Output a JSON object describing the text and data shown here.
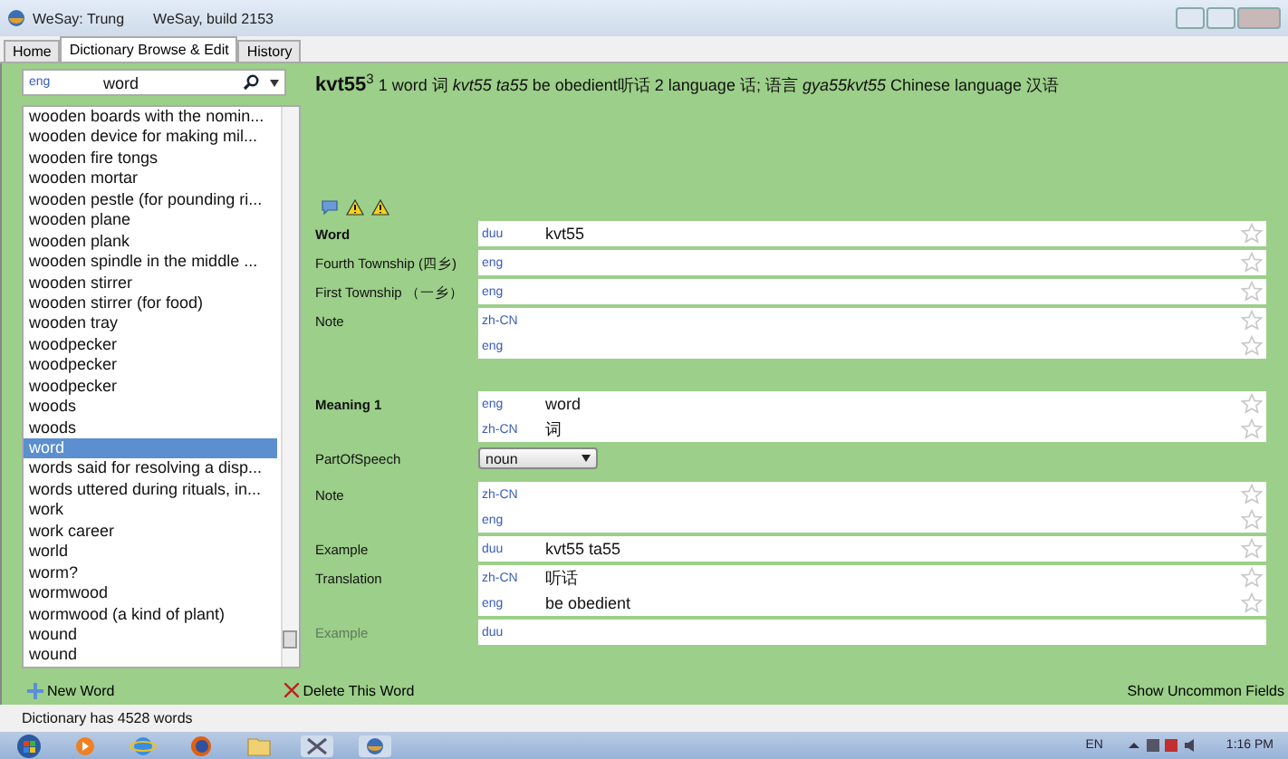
{
  "window": {
    "title": "WeSay: Trung",
    "build": "WeSay, build 2153"
  },
  "tabs": [
    {
      "label": "Home",
      "selected": false
    },
    {
      "label": "Dictionary Browse & Edit",
      "selected": true
    },
    {
      "label": "History",
      "selected": false
    }
  ],
  "search": {
    "lang": "eng",
    "value": "word"
  },
  "word_list": [
    {
      "label": "wooden boards with the nomin...",
      "selected": false
    },
    {
      "label": "wooden device for making mil...",
      "selected": false
    },
    {
      "label": "wooden fire tongs",
      "selected": false
    },
    {
      "label": "wooden mortar",
      "selected": false
    },
    {
      "label": "wooden pestle (for pounding ri...",
      "selected": false
    },
    {
      "label": "wooden plane",
      "selected": false
    },
    {
      "label": "wooden plank",
      "selected": false
    },
    {
      "label": "wooden spindle in the middle ...",
      "selected": false
    },
    {
      "label": "wooden stirrer",
      "selected": false
    },
    {
      "label": "wooden stirrer (for food)",
      "selected": false
    },
    {
      "label": "wooden tray",
      "selected": false
    },
    {
      "label": "woodpecker",
      "selected": false
    },
    {
      "label": "woodpecker",
      "selected": false
    },
    {
      "label": "woodpecker",
      "selected": false
    },
    {
      "label": "woods",
      "selected": false
    },
    {
      "label": "woods",
      "selected": false
    },
    {
      "label": "word",
      "selected": true
    },
    {
      "label": "words said for resolving a disp...",
      "selected": false
    },
    {
      "label": "words uttered during rituals, in...",
      "selected": false
    },
    {
      "label": "work",
      "selected": false
    },
    {
      "label": "work career",
      "selected": false
    },
    {
      "label": "world",
      "selected": false
    },
    {
      "label": "worm?",
      "selected": false
    },
    {
      "label": "wormwood",
      "selected": false
    },
    {
      "label": "wormwood (a kind of plant)",
      "selected": false
    },
    {
      "label": "wound",
      "selected": false
    },
    {
      "label": "wound",
      "selected": false
    }
  ],
  "entry_preview": "**kvt55**$^{3}$ 1 word 词 *kvt55 ta55* be obedient听话 2 language 话; 语言 *gya55kvt55* Chinese language 汉语",
  "fields": [
    {
      "label": "Word",
      "kind": "text",
      "heading": true,
      "disabled": false,
      "gap_before": false,
      "lines": [
        {
          "lang": "duu",
          "value": "kvt55"
        }
      ]
    },
    {
      "label": "Fourth Township (四乡)",
      "kind": "text",
      "heading": false,
      "disabled": false,
      "gap_before": false,
      "lines": [
        {
          "lang": "eng"
        }
      ]
    },
    {
      "label": "First Township （一乡）",
      "kind": "text",
      "heading": false,
      "disabled": false,
      "gap_before": false,
      "lines": [
        {
          "lang": "eng"
        }
      ]
    },
    {
      "label": "Note",
      "kind": "text",
      "heading": false,
      "disabled": false,
      "gap_before": false,
      "lines": [
        {
          "lang": "zh-CN"
        },
        {
          "lang": "eng"
        }
      ]
    },
    {
      "label": "Meaning 1",
      "kind": "text",
      "heading": true,
      "disabled": false,
      "gap_before": true,
      "lines": [
        {
          "lang": "eng",
          "value": "word"
        },
        {
          "lang": "zh-CN",
          "value": "词"
        }
      ]
    },
    {
      "label": "PartOfSpeech",
      "kind": "select",
      "heading": false,
      "disabled": false,
      "gap_before": false,
      "value": "noun"
    },
    {
      "label": "Note",
      "kind": "text",
      "heading": false,
      "disabled": false,
      "gap_before": false,
      "lines": [
        {
          "lang": "zh-CN"
        },
        {
          "lang": "eng"
        }
      ]
    },
    {
      "label": "Example",
      "kind": "text",
      "heading": false,
      "disabled": false,
      "gap_before": false,
      "lines": [
        {
          "lang": "duu",
          "value": "kvt55 ta55"
        }
      ]
    },
    {
      "label": "Translation",
      "kind": "text",
      "heading": false,
      "disabled": false,
      "gap_before": false,
      "lines": [
        {
          "lang": "zh-CN",
          "value": "听话"
        },
        {
          "lang": "eng",
          "value": "be obedient"
        }
      ]
    },
    {
      "label": "Example",
      "kind": "text",
      "heading": false,
      "disabled": true,
      "gap_before": false,
      "lines": [
        {
          "lang": "duu"
        }
      ]
    }
  ],
  "actions": {
    "new_word": "New Word",
    "delete_word": "Delete This Word",
    "show_uncommon": "Show Uncommon Fields"
  },
  "status_bar": "Dictionary has 4528 words",
  "taskbar": {
    "language": "EN",
    "time": "1:16 PM"
  }
}
